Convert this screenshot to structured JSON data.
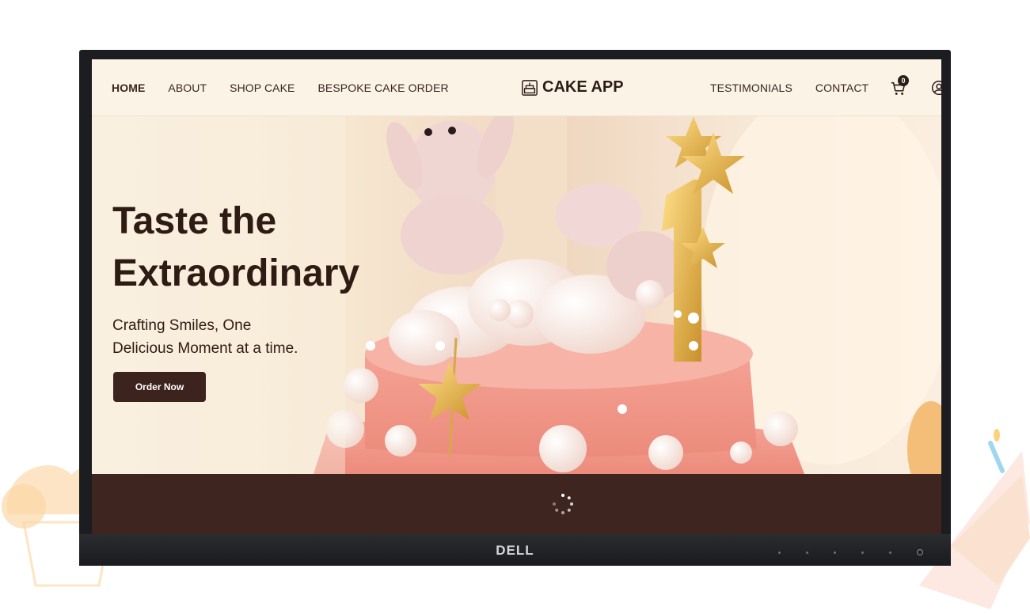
{
  "nav": {
    "left_items": [
      {
        "label": "HOME",
        "active": true
      },
      {
        "label": "ABOUT",
        "active": false
      },
      {
        "label": "SHOP CAKE",
        "active": false
      },
      {
        "label": "BESPOKE CAKE ORDER",
        "active": false
      }
    ],
    "logo_text": "CAKE APP",
    "logo_icon": "cake-icon",
    "right_items": [
      {
        "label": "TESTIMONIALS"
      },
      {
        "label": "CONTACT"
      }
    ],
    "cart_count": "0",
    "cart_icon": "cart-icon",
    "user_icon": "user-icon"
  },
  "hero": {
    "title_line1": "Taste the",
    "title_line2": "Extraordinary",
    "subtitle_line1": "Crafting Smiles, One",
    "subtitle_line2": "Delicious Moment at a time.",
    "cta_label": "Order Now"
  },
  "loader": {
    "icon": "spinner-icon"
  },
  "monitor": {
    "brand": "DELL"
  },
  "colors": {
    "primary_brown": "#3e2520",
    "nav_bg": "#faf3e6",
    "cake_pink": "#f29a8c",
    "gold": "#e6b434"
  }
}
